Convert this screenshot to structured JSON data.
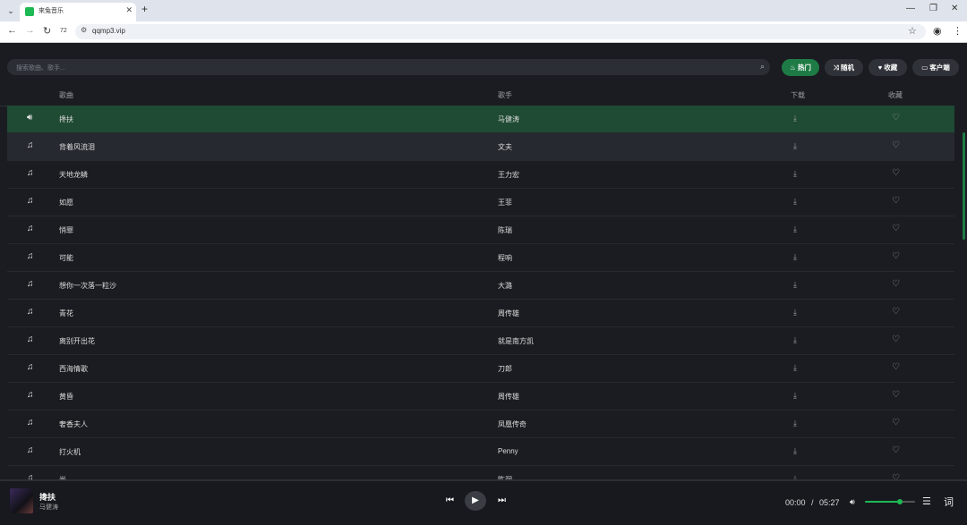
{
  "browser": {
    "tab_title": "來兔音乐",
    "url": "qqmp3.vip",
    "zoom_text": "72"
  },
  "search": {
    "placeholder": "搜索歌曲、歌手..."
  },
  "nav_pills": [
    {
      "label": "热门",
      "icon": "fire-icon",
      "active": true
    },
    {
      "label": "随机",
      "icon": "shuffle-icon",
      "active": false
    },
    {
      "label": "收藏",
      "icon": "heart-icon",
      "active": false
    },
    {
      "label": "客户端",
      "icon": "desktop-icon",
      "active": false
    }
  ],
  "table": {
    "headers": {
      "song": "歌曲",
      "artist": "歌手",
      "download": "下载",
      "favorite": "收藏"
    },
    "rows": [
      {
        "song": "搀扶",
        "artist": "马健涛",
        "playing": true
      },
      {
        "song": "背着风流泪",
        "artist": "文夫"
      },
      {
        "song": "天地龙鳞",
        "artist": "王力宏"
      },
      {
        "song": "如愿",
        "artist": "王菲"
      },
      {
        "song": "悄罪",
        "artist": "陈瑞"
      },
      {
        "song": "可能",
        "artist": "程响"
      },
      {
        "song": "想你一次落一粒沙",
        "artist": "大潞"
      },
      {
        "song": "青花",
        "artist": "周传雄"
      },
      {
        "song": "离别开出花",
        "artist": "就是南方凯"
      },
      {
        "song": "西海情歌",
        "artist": "刀郎"
      },
      {
        "song": "黄昏",
        "artist": "周传雄"
      },
      {
        "song": "奢香夫人",
        "artist": "凤凰传奇"
      },
      {
        "song": "打火机",
        "artist": "Penny"
      },
      {
        "song": "光",
        "artist": "陈洞"
      }
    ]
  },
  "player": {
    "title": "搀扶",
    "artist": "马健涛",
    "current_time": "00:00",
    "separator": "/",
    "total_time": "05:27",
    "volume_level": 0.7,
    "lyric_label": "词"
  },
  "colors": {
    "accent": "#1e7b45",
    "background": "#1a1c21",
    "playing_row": "#1f4a33"
  }
}
